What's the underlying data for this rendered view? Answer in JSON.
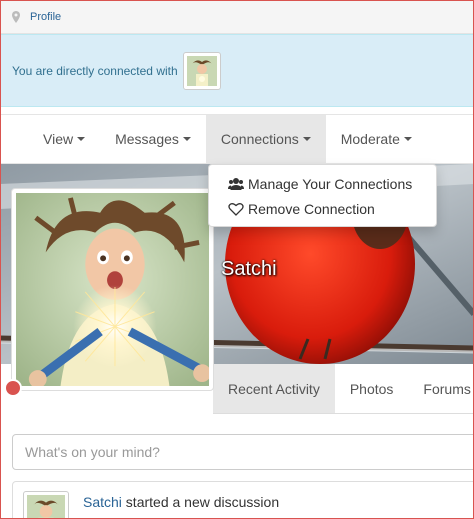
{
  "breadcrumb": {
    "icon": "map-pin-icon",
    "label": "Profile"
  },
  "banner": {
    "text": "You are directly connected with"
  },
  "nav": {
    "items": [
      {
        "label": "View"
      },
      {
        "label": "Messages"
      },
      {
        "label": "Connections"
      },
      {
        "label": "Moderate"
      }
    ],
    "active": "Connections"
  },
  "dropdown": {
    "items": [
      {
        "label": "Manage Your Connections",
        "icon": "users-icon"
      },
      {
        "label": "Remove Connection",
        "icon": "heart-outline-icon"
      }
    ]
  },
  "profile": {
    "name": "Satchi"
  },
  "tabs": {
    "items": [
      {
        "label": "Recent Activity"
      },
      {
        "label": "Photos"
      },
      {
        "label": "Forums"
      }
    ],
    "active": "Recent Activity"
  },
  "status_input": {
    "placeholder": "What's on your mind?"
  },
  "activity": {
    "user": "Satchi",
    "text": " started a new discussion"
  },
  "colors": {
    "link": "#2a6496",
    "banner_bg": "#d9edf7",
    "banner_text": "#31708f",
    "active_tab_bg": "#e7e7e7",
    "status_dot": "#d9534f"
  }
}
